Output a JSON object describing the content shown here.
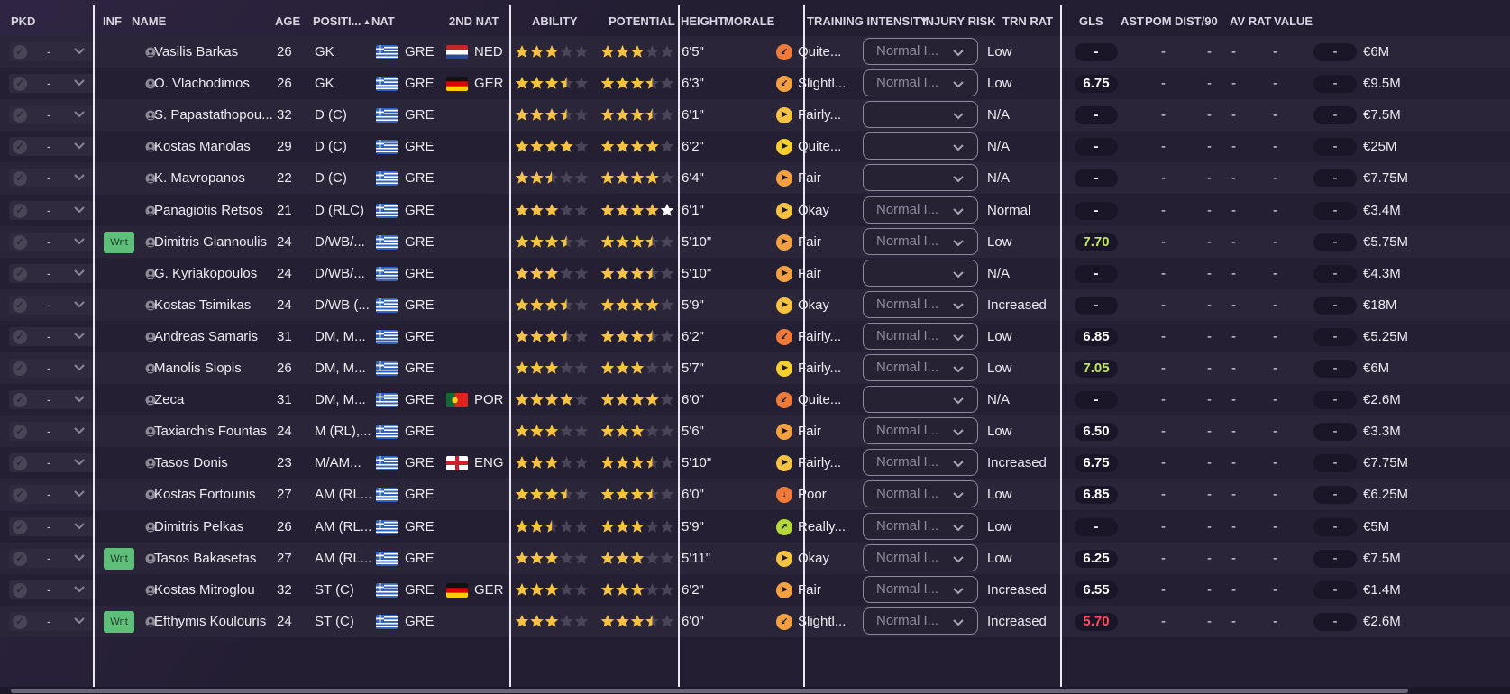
{
  "colors": {
    "star_filled": "#f5c242",
    "star_empty": "#4a4558",
    "star_potential_white": "#ffffff",
    "trn_good": "#c2e85a",
    "trn_bad": "#ff4a5c",
    "trn_normal": "#ffffff",
    "wnt_badge": "#5fbf7a"
  },
  "headers": {
    "pkd": "PKD",
    "inf": "INF",
    "name": "NAME",
    "age": "AGE",
    "position": "POSITI...",
    "nat": "NAT",
    "nat2": "2ND NAT",
    "ability": "ABILITY",
    "potential": "POTENTIAL",
    "height": "HEIGHT",
    "morale": "MORALE",
    "training": "TRAINING INTENSITY",
    "injury": "INJURY RISK",
    "trn": "TRN RAT",
    "gls": "GLS",
    "ast": "AST",
    "pom": "POM",
    "dist": "DIST/90",
    "avr": "AV RAT",
    "value": "VALUE"
  },
  "players": [
    {
      "pkd": "-",
      "inf": "",
      "name": "Vasilis Barkas",
      "age": "26",
      "pos": "GK",
      "nat": "GRE",
      "nat_flag": "greece",
      "nat2": "NED",
      "nat2_flag": "netherlands",
      "ability": 3,
      "potential": 3,
      "potential_white": false,
      "height": "6'5\"",
      "morale_icon": "down-left",
      "morale_color": "#f07a3a",
      "morale": "Quite...",
      "training": "Normal I...",
      "injury": "Low",
      "trn": "-",
      "trn_color": "normal",
      "gls": "-",
      "ast": "-",
      "pom": "-",
      "dist": "-",
      "avr": "-",
      "value": "€6M"
    },
    {
      "pkd": "-",
      "inf": "",
      "name": "O. Vlachodimos",
      "age": "26",
      "pos": "GK",
      "nat": "GRE",
      "nat_flag": "greece",
      "nat2": "GER",
      "nat2_flag": "germany",
      "ability": 3.5,
      "potential": 3.5,
      "potential_white": false,
      "height": "6'3\"",
      "morale_icon": "down-left",
      "morale_color": "#f5a040",
      "morale": "Slightl...",
      "training": "Normal I...",
      "injury": "Low",
      "trn": "6.75",
      "trn_color": "normal",
      "gls": "-",
      "ast": "-",
      "pom": "-",
      "dist": "-",
      "avr": "-",
      "value": "€9.5M"
    },
    {
      "pkd": "-",
      "inf": "",
      "name": "S. Papastathopou...",
      "age": "32",
      "pos": "D (C)",
      "nat": "GRE",
      "nat_flag": "greece",
      "nat2": "",
      "nat2_flag": "",
      "ability": 3.5,
      "potential": 3.5,
      "potential_white": false,
      "height": "6'1\"",
      "morale_icon": "right",
      "morale_color": "#f5c242",
      "morale": "Fairly...",
      "training": "",
      "injury": "N/A",
      "trn": "-",
      "trn_color": "normal",
      "gls": "-",
      "ast": "-",
      "pom": "-",
      "dist": "-",
      "avr": "-",
      "value": "€7.5M"
    },
    {
      "pkd": "-",
      "inf": "",
      "name": "Kostas Manolas",
      "age": "29",
      "pos": "D (C)",
      "nat": "GRE",
      "nat_flag": "greece",
      "nat2": "",
      "nat2_flag": "",
      "ability": 4,
      "potential": 4,
      "potential_white": false,
      "height": "6'2\"",
      "morale_icon": "right",
      "morale_color": "#f5d030",
      "morale": "Quite...",
      "training": "",
      "injury": "N/A",
      "trn": "-",
      "trn_color": "normal",
      "gls": "-",
      "ast": "-",
      "pom": "-",
      "dist": "-",
      "avr": "-",
      "value": "€25M"
    },
    {
      "pkd": "-",
      "inf": "",
      "name": "K. Mavropanos",
      "age": "22",
      "pos": "D (C)",
      "nat": "GRE",
      "nat_flag": "greece",
      "nat2": "",
      "nat2_flag": "",
      "ability": 2.5,
      "potential": 4,
      "potential_white": false,
      "height": "6'4\"",
      "morale_icon": "right",
      "morale_color": "#f5a040",
      "morale": "Fair",
      "training": "",
      "injury": "N/A",
      "trn": "-",
      "trn_color": "normal",
      "gls": "-",
      "ast": "-",
      "pom": "-",
      "dist": "-",
      "avr": "-",
      "value": "€7.75M"
    },
    {
      "pkd": "-",
      "inf": "",
      "name": "Panagiotis Retsos",
      "age": "21",
      "pos": "D (RLC)",
      "nat": "GRE",
      "nat_flag": "greece",
      "nat2": "",
      "nat2_flag": "",
      "ability": 3,
      "potential": 5,
      "potential_white": true,
      "height": "6'1\"",
      "morale_icon": "right",
      "morale_color": "#f5c242",
      "morale": "Okay",
      "training": "Normal I...",
      "injury": "Normal",
      "trn": "-",
      "trn_color": "normal",
      "gls": "-",
      "ast": "-",
      "pom": "-",
      "dist": "-",
      "avr": "-",
      "value": "€3.4M"
    },
    {
      "pkd": "-",
      "inf": "Wnt",
      "name": "Dimitris Giannoulis",
      "age": "24",
      "pos": "D/WB/...",
      "nat": "GRE",
      "nat_flag": "greece",
      "nat2": "",
      "nat2_flag": "",
      "ability": 3.5,
      "potential": 3.5,
      "potential_white": false,
      "height": "5'10\"",
      "morale_icon": "right",
      "morale_color": "#f5a040",
      "morale": "Fair",
      "training": "Normal I...",
      "injury": "Low",
      "trn": "7.70",
      "trn_color": "good",
      "gls": "-",
      "ast": "-",
      "pom": "-",
      "dist": "-",
      "avr": "-",
      "value": "€5.75M"
    },
    {
      "pkd": "-",
      "inf": "",
      "name": "G. Kyriakopoulos",
      "age": "24",
      "pos": "D/WB/...",
      "nat": "GRE",
      "nat_flag": "greece",
      "nat2": "",
      "nat2_flag": "",
      "ability": 3,
      "potential": 3.5,
      "potential_white": false,
      "height": "5'10\"",
      "morale_icon": "right",
      "morale_color": "#f5a040",
      "morale": "Fair",
      "training": "",
      "injury": "N/A",
      "trn": "-",
      "trn_color": "normal",
      "gls": "-",
      "ast": "-",
      "pom": "-",
      "dist": "-",
      "avr": "-",
      "value": "€4.3M"
    },
    {
      "pkd": "-",
      "inf": "",
      "name": "Kostas Tsimikas",
      "age": "24",
      "pos": "D/WB (...",
      "nat": "GRE",
      "nat_flag": "greece",
      "nat2": "",
      "nat2_flag": "",
      "ability": 3.5,
      "potential": 4,
      "potential_white": false,
      "height": "5'9\"",
      "morale_icon": "right",
      "morale_color": "#f5c242",
      "morale": "Okay",
      "training": "Normal I...",
      "injury": "Increased",
      "trn": "-",
      "trn_color": "normal",
      "gls": "-",
      "ast": "-",
      "pom": "-",
      "dist": "-",
      "avr": "-",
      "value": "€18M"
    },
    {
      "pkd": "-",
      "inf": "",
      "name": "Andreas Samaris",
      "age": "31",
      "pos": "DM, M...",
      "nat": "GRE",
      "nat_flag": "greece",
      "nat2": "",
      "nat2_flag": "",
      "ability": 3.5,
      "potential": 3.5,
      "potential_white": false,
      "height": "6'2\"",
      "morale_icon": "down-left",
      "morale_color": "#f07a3a",
      "morale": "Fairly...",
      "training": "Normal I...",
      "injury": "Low",
      "trn": "6.85",
      "trn_color": "normal",
      "gls": "-",
      "ast": "-",
      "pom": "-",
      "dist": "-",
      "avr": "-",
      "value": "€5.25M"
    },
    {
      "pkd": "-",
      "inf": "",
      "name": "Manolis Siopis",
      "age": "26",
      "pos": "DM, M...",
      "nat": "GRE",
      "nat_flag": "greece",
      "nat2": "",
      "nat2_flag": "",
      "ability": 3,
      "potential": 3,
      "potential_white": false,
      "height": "5'7\"",
      "morale_icon": "right",
      "morale_color": "#f5d030",
      "morale": "Fairly...",
      "training": "Normal I...",
      "injury": "Low",
      "trn": "7.05",
      "trn_color": "good",
      "gls": "-",
      "ast": "-",
      "pom": "-",
      "dist": "-",
      "avr": "-",
      "value": "€6M"
    },
    {
      "pkd": "-",
      "inf": "",
      "name": "Zeca",
      "age": "31",
      "pos": "DM, M...",
      "nat": "GRE",
      "nat_flag": "greece",
      "nat2": "POR",
      "nat2_flag": "portugal",
      "ability": 4,
      "potential": 4,
      "potential_white": false,
      "height": "6'0\"",
      "morale_icon": "down-left",
      "morale_color": "#f07a3a",
      "morale": "Quite...",
      "training": "",
      "injury": "N/A",
      "trn": "-",
      "trn_color": "normal",
      "gls": "-",
      "ast": "-",
      "pom": "-",
      "dist": "-",
      "avr": "-",
      "value": "€2.6M"
    },
    {
      "pkd": "-",
      "inf": "",
      "name": "Taxiarchis Fountas",
      "age": "24",
      "pos": "M (RL),...",
      "nat": "GRE",
      "nat_flag": "greece",
      "nat2": "",
      "nat2_flag": "",
      "ability": 3,
      "potential": 3,
      "potential_white": false,
      "height": "5'6\"",
      "morale_icon": "right",
      "morale_color": "#f5a040",
      "morale": "Fair",
      "training": "Normal I...",
      "injury": "Low",
      "trn": "6.50",
      "trn_color": "normal",
      "gls": "-",
      "ast": "-",
      "pom": "-",
      "dist": "-",
      "avr": "-",
      "value": "€3.3M"
    },
    {
      "pkd": "-",
      "inf": "",
      "name": "Tasos Donis",
      "age": "23",
      "pos": "M/AM...",
      "nat": "GRE",
      "nat_flag": "greece",
      "nat2": "ENG",
      "nat2_flag": "england",
      "ability": 3,
      "potential": 3.5,
      "potential_white": false,
      "height": "5'10\"",
      "morale_icon": "right",
      "morale_color": "#f5c242",
      "morale": "Fairly...",
      "training": "Normal I...",
      "injury": "Increased",
      "trn": "6.75",
      "trn_color": "normal",
      "gls": "-",
      "ast": "-",
      "pom": "-",
      "dist": "-",
      "avr": "-",
      "value": "€7.75M"
    },
    {
      "pkd": "-",
      "inf": "",
      "name": "Kostas Fortounis",
      "age": "27",
      "pos": "AM (RL...",
      "nat": "GRE",
      "nat_flag": "greece",
      "nat2": "",
      "nat2_flag": "",
      "ability": 3.5,
      "potential": 3.5,
      "potential_white": false,
      "height": "6'0\"",
      "morale_icon": "down",
      "morale_color": "#f07a3a",
      "morale": "Poor",
      "training": "Normal I...",
      "injury": "Low",
      "trn": "6.85",
      "trn_color": "normal",
      "gls": "-",
      "ast": "-",
      "pom": "-",
      "dist": "-",
      "avr": "-",
      "value": "€6.25M"
    },
    {
      "pkd": "-",
      "inf": "",
      "name": "Dimitris Pelkas",
      "age": "26",
      "pos": "AM (RL...",
      "nat": "GRE",
      "nat_flag": "greece",
      "nat2": "",
      "nat2_flag": "",
      "ability": 2.5,
      "potential": 3,
      "potential_white": false,
      "height": "5'9\"",
      "morale_icon": "up-right",
      "morale_color": "#b5d83a",
      "morale": "Really...",
      "training": "Normal I...",
      "injury": "Low",
      "trn": "-",
      "trn_color": "normal",
      "gls": "-",
      "ast": "-",
      "pom": "-",
      "dist": "-",
      "avr": "-",
      "value": "€5M"
    },
    {
      "pkd": "-",
      "inf": "Wnt",
      "name": "Tasos Bakasetas",
      "age": "27",
      "pos": "AM (RL...",
      "nat": "GRE",
      "nat_flag": "greece",
      "nat2": "",
      "nat2_flag": "",
      "ability": 3,
      "potential": 3,
      "potential_white": false,
      "height": "5'11\"",
      "morale_icon": "right",
      "morale_color": "#f5c242",
      "morale": "Okay",
      "training": "Normal I...",
      "injury": "Low",
      "trn": "6.25",
      "trn_color": "normal",
      "gls": "-",
      "ast": "-",
      "pom": "-",
      "dist": "-",
      "avr": "-",
      "value": "€7.5M"
    },
    {
      "pkd": "-",
      "inf": "",
      "name": "Kostas Mitroglou",
      "age": "32",
      "pos": "ST (C)",
      "nat": "GRE",
      "nat_flag": "greece",
      "nat2": "GER",
      "nat2_flag": "germany",
      "ability": 3,
      "potential": 3,
      "potential_white": false,
      "height": "6'2\"",
      "morale_icon": "right",
      "morale_color": "#f5a040",
      "morale": "Fair",
      "training": "Normal I...",
      "injury": "Increased",
      "trn": "6.55",
      "trn_color": "normal",
      "gls": "-",
      "ast": "-",
      "pom": "-",
      "dist": "-",
      "avr": "-",
      "value": "€1.4M"
    },
    {
      "pkd": "-",
      "inf": "Wnt",
      "name": "Efthymis Koulouris",
      "age": "24",
      "pos": "ST (C)",
      "nat": "GRE",
      "nat_flag": "greece",
      "nat2": "",
      "nat2_flag": "",
      "ability": 3,
      "potential": 3.5,
      "potential_white": false,
      "height": "6'0\"",
      "morale_icon": "down-left",
      "morale_color": "#f5a040",
      "morale": "Slightl...",
      "training": "Normal I...",
      "injury": "Increased",
      "trn": "5.70",
      "trn_color": "bad",
      "gls": "-",
      "ast": "-",
      "pom": "-",
      "dist": "-",
      "avr": "-",
      "value": "€2.6M"
    }
  ]
}
